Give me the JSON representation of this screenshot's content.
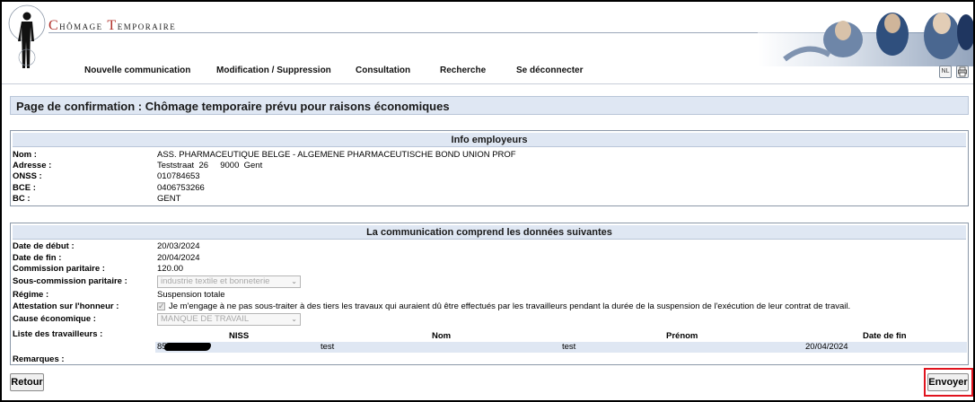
{
  "header": {
    "brand_first_cap": "C",
    "brand_first_rest": "hômage ",
    "brand_second_cap": "T",
    "brand_second_rest": "emporaire"
  },
  "nav": {
    "items": [
      {
        "label": "Nouvelle communication"
      },
      {
        "label": "Modification / Suppression"
      },
      {
        "label": "Consultation"
      },
      {
        "label": "Recherche"
      },
      {
        "label": "Se déconnecter"
      }
    ],
    "lang_icon": "NL",
    "print_icon": "printer-icon"
  },
  "page": {
    "title": "Page de confirmation : Chômage temporaire prévu pour raisons économiques"
  },
  "employer": {
    "heading": "Info employeurs",
    "rows": [
      {
        "label": "Nom :",
        "value": "ASS. PHARMACEUTIQUE BELGE - ALGEMENE PHARMACEUTISCHE BOND UNION PROF"
      },
      {
        "label": "Adresse :",
        "value": "Teststraat  26     9000  Gent"
      },
      {
        "label": "ONSS :",
        "value": "010784653"
      },
      {
        "label": "BCE :",
        "value": "0406753266"
      },
      {
        "label": "BC :",
        "value": "GENT"
      }
    ]
  },
  "communication": {
    "heading": "La communication comprend les données suivantes",
    "date_debut_label": "Date de début :",
    "date_debut": "20/03/2024",
    "date_fin_label": "Date de fin :",
    "date_fin": "20/04/2024",
    "commission_label": "Commission paritaire :",
    "commission": "120.00",
    "sous_commission_label": "Sous-commission paritaire :",
    "sous_commission": "industrie textile et bonneterie",
    "regime_label": "Régime :",
    "regime": "Suspension totale",
    "attestation_label": "Attestation sur l'honneur :",
    "attestation_text": "Je m'engage à ne pas sous-traiter à des tiers les travaux qui auraient dû être effectués par les travailleurs pendant la durée de la suspension de l'exécution de leur contrat de travail.",
    "attestation_checked": true,
    "cause_label": "Cause économique :",
    "cause": "MANQUE DE TRAVAIL",
    "workers_label": "Liste des travailleurs :",
    "workers_columns": [
      "NISS",
      "Nom",
      "Prénom",
      "Date de fin"
    ],
    "workers": [
      {
        "niss": "85",
        "nom": "test",
        "prenom": "test",
        "date_fin": "20/04/2024"
      }
    ],
    "remarques_label": "Remarques :"
  },
  "buttons": {
    "retour": "Retour",
    "envoyer": "Envoyer"
  },
  "colors": {
    "panel_header_bg": "#dfe7f3",
    "highlight_border": "#e0141e",
    "brand_accent": "#b0302a"
  }
}
